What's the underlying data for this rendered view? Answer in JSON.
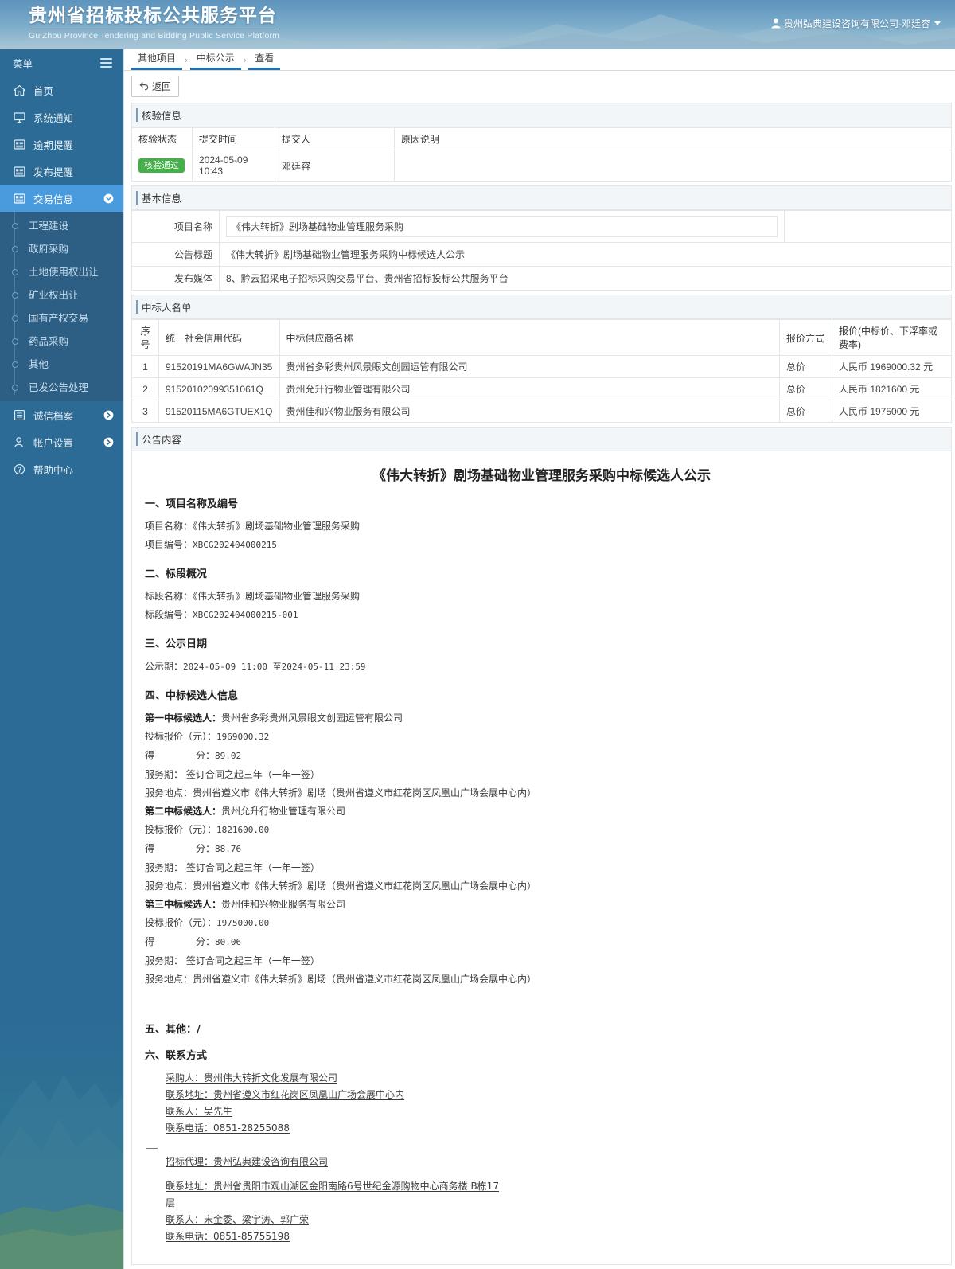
{
  "header": {
    "title": "贵州省招标投标公共服务平台",
    "subtitle": "GuiZhou Province Tendering and Bidding Public Service Platform",
    "user": "贵州弘典建设咨询有限公司-邓廷容",
    "user_icon": "user-icon"
  },
  "sidebar": {
    "menu_label": "菜单",
    "toggle_icon": "hamburger-icon",
    "items": [
      {
        "label": "首页",
        "icon": "home-icon",
        "active": false,
        "expandable": false
      },
      {
        "label": "系统通知",
        "icon": "monitor-icon",
        "active": false,
        "expandable": false
      },
      {
        "label": "逾期提醒",
        "icon": "document-icon",
        "active": false,
        "expandable": false
      },
      {
        "label": "发布提醒",
        "icon": "document-icon",
        "active": false,
        "expandable": false
      },
      {
        "label": "交易信息",
        "icon": "document-icon",
        "active": true,
        "expandable": true
      }
    ],
    "submenu": [
      "工程建设",
      "政府采购",
      "土地使用权出让",
      "矿业权出让",
      "国有产权交易",
      "药品采购",
      "其他",
      "已发公告处理"
    ],
    "items_after": [
      {
        "label": "诚信档案",
        "icon": "list-icon",
        "expandable": true
      },
      {
        "label": "帐户设置",
        "icon": "person-icon",
        "expandable": true
      },
      {
        "label": "帮助中心",
        "icon": "question-icon",
        "expandable": false
      }
    ]
  },
  "breadcrumb": {
    "items": [
      "其他项目",
      "中标公示",
      "查看"
    ],
    "separator": "›"
  },
  "toolbar": {
    "back_label": "返回",
    "back_icon": "undo-icon"
  },
  "verify_section": {
    "title": "核验信息",
    "columns": [
      "核验状态",
      "提交时间",
      "提交人",
      "原因说明"
    ],
    "rows": [
      {
        "status": "核验通过",
        "time": "2024-05-09 10:43",
        "person": "邓廷容",
        "reason": ""
      }
    ]
  },
  "basic_section": {
    "title": "基本信息",
    "fields": [
      {
        "label": "项目名称",
        "value": "《伟大转折》剧场基础物业管理服务采购",
        "boxed": true
      },
      {
        "label": "公告标题",
        "value": "《伟大转折》剧场基础物业管理服务采购中标候选人公示",
        "boxed": false
      },
      {
        "label": "发布媒体",
        "value": "8、黔云招采电子招标采购交易平台、贵州省招标投标公共服务平台",
        "boxed": false
      }
    ]
  },
  "winner_section": {
    "title": "中标人名单",
    "columns": [
      "序号",
      "统一社会信用代码",
      "中标供应商名称",
      "报价方式",
      "报价(中标价、下浮率或费率)"
    ],
    "rows": [
      {
        "no": "1",
        "code": "91520191MA6GWAJN35",
        "supplier": "贵州省多彩贵州风景眼文创园运管有限公司",
        "mode": "总价",
        "price": "人民币 1969000.32 元"
      },
      {
        "no": "2",
        "code": "91520102099351061Q",
        "supplier": "贵州允升行物业管理有限公司",
        "mode": "总价",
        "price": "人民币 1821600 元"
      },
      {
        "no": "3",
        "code": "91520115MA6GTUEX1Q",
        "supplier": "贵州佳和兴物业服务有限公司",
        "mode": "总价",
        "price": "人民币 1975000 元"
      }
    ]
  },
  "announcement": {
    "panel_title": "公告内容",
    "doc_title": "《伟大转折》剧场基础物业管理服务采购中标候选人公示",
    "sec1_heading": "一、项目名称及编号",
    "sec1_lines": [
      {
        "label": "项目名称：",
        "value": "《伟大转折》剧场基础物业管理服务采购",
        "mono": false
      },
      {
        "label": "项目编号：",
        "value": "XBCG202404000215",
        "mono": true
      }
    ],
    "sec2_heading": "二、标段概况",
    "sec2_lines": [
      {
        "label": "标段名称：",
        "value": "《伟大转折》剧场基础物业管理服务采购",
        "mono": false
      },
      {
        "label": "标段编号：",
        "value": "XBCG202404000215-001",
        "mono": true
      }
    ],
    "sec3_heading": "三、公示日期",
    "sec3_label": "公示期：",
    "sec3_value": "2024-05-09 11:00 至2024-05-11 23:59",
    "sec4_heading": "四、中标候选人信息",
    "candidates": [
      {
        "rank_label": "第一中标候选人：",
        "company": "贵州省多彩贵州风景眼文创园运管有限公司",
        "price_label": "投标报价（元）：",
        "price": "1969000.32",
        "score_label_a": "得",
        "score_label_b": "分：",
        "score": "89.02",
        "period_label": "服务期：",
        "period": "签订合同之起三年（一年一签）",
        "place_label": "服务地点：",
        "place": "贵州省遵义市《伟大转折》剧场（贵州省遵义市红花岗区凤凰山广场会展中心内）"
      },
      {
        "rank_label": "第二中标候选人：",
        "company": "贵州允升行物业管理有限公司",
        "price_label": "投标报价（元）：",
        "price": "1821600.00",
        "score_label_a": "得",
        "score_label_b": "分：",
        "score": "88.76",
        "period_label": "服务期：",
        "period": "签订合同之起三年（一年一签）",
        "place_label": "服务地点：",
        "place": "贵州省遵义市《伟大转折》剧场（贵州省遵义市红花岗区凤凰山广场会展中心内）"
      },
      {
        "rank_label": "第三中标候选人：",
        "company": "贵州佳和兴物业服务有限公司",
        "price_label": "投标报价（元）：",
        "price": "1975000.00",
        "score_label_a": "得",
        "score_label_b": "分：",
        "score": "80.06",
        "period_label": "服务期：",
        "period": "签订合同之起三年（一年一签）",
        "place_label": "服务地点：",
        "place": "贵州省遵义市《伟大转折》剧场（贵州省遵义市红花岗区凤凰山广场会展中心内）"
      }
    ],
    "sec5_heading": "五、其他：/",
    "sec6_heading": "六、联系方式",
    "contact_purchaser": [
      "采购人：贵州伟大转折文化发展有限公司",
      "联系地址：贵州省遵义市红花岗区凤凰山广场会展中心内",
      "联系人：吴先生",
      "联系电话：0851-28255088"
    ],
    "contact_agent_title": "招标代理：贵州弘典建设咨询有限公司",
    "contact_agent": [
      "联系地址：贵州省贵阳市观山湖区金阳南路6号世纪金源购物中心商务楼 B栋17层",
      "联系人：宋金委、梁宇涛、郭广荣",
      "联系电话：0851-85755198"
    ]
  },
  "colors": {
    "header_blue": "#5b93bd",
    "sidebar_blue": "#2c6b96",
    "sidebar_active": "#4a9bdd",
    "submenu_blue": "#2d5f84",
    "accent": "#1f6fb2",
    "badge_green": "#43b149"
  }
}
